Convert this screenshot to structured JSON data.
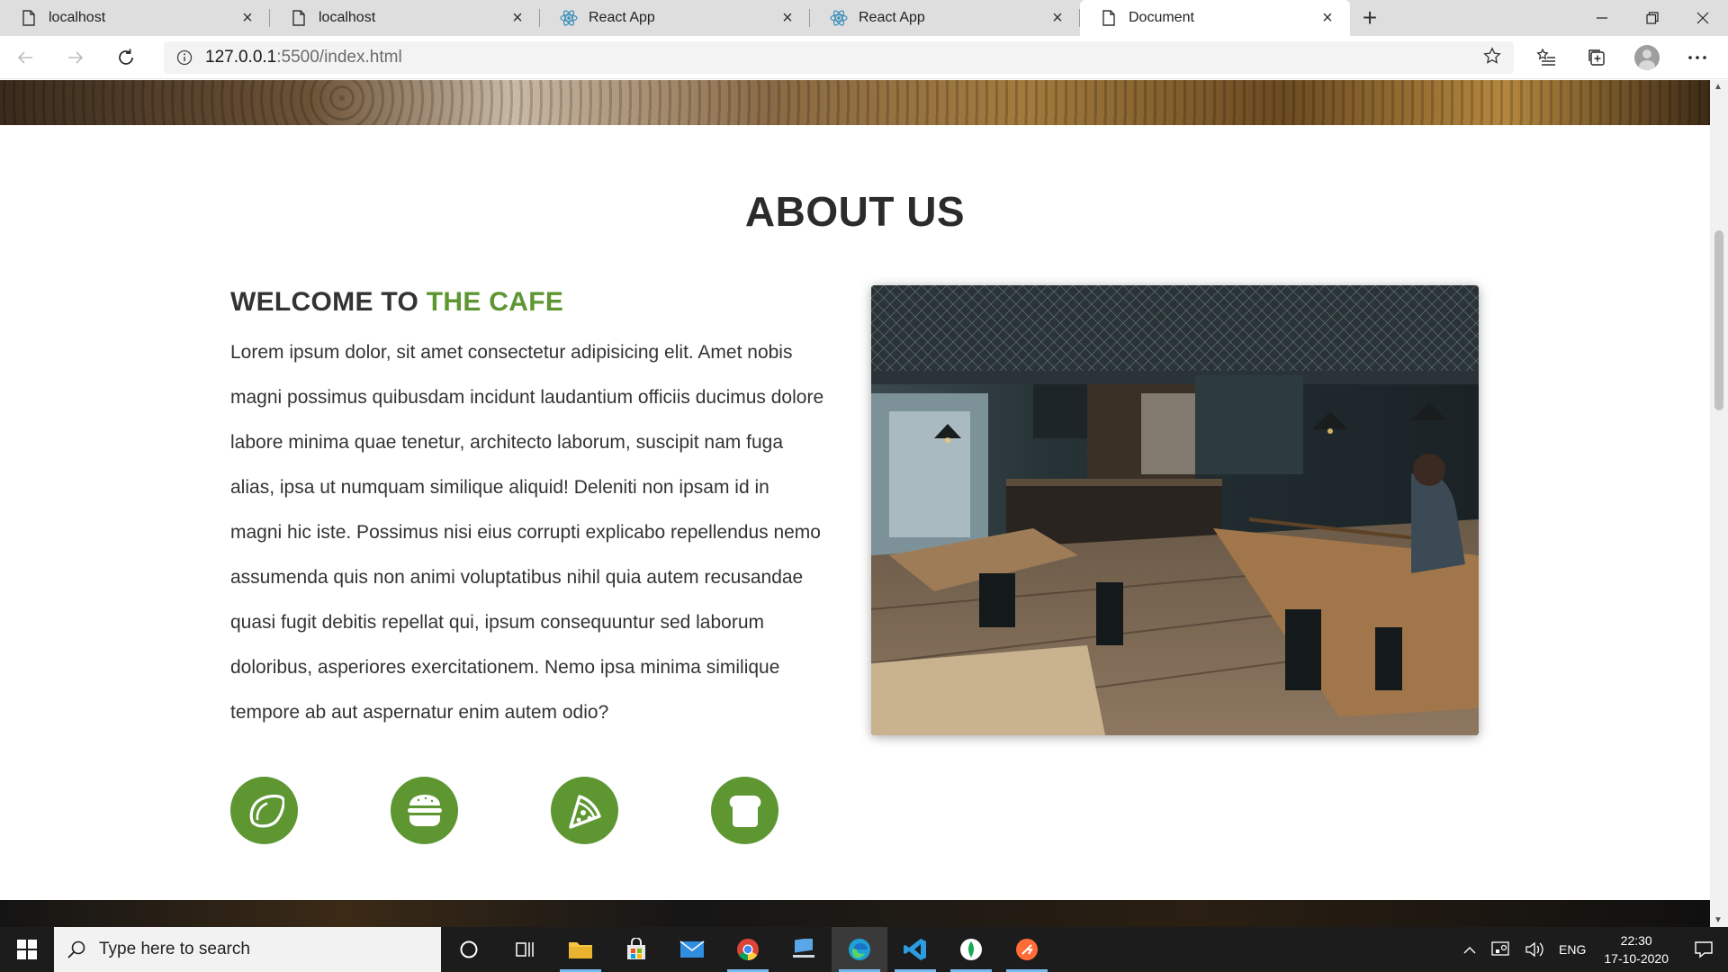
{
  "browser": {
    "tabs": [
      {
        "label": "localhost",
        "icon": "page-icon"
      },
      {
        "label": "localhost",
        "icon": "page-icon"
      },
      {
        "label": "React App",
        "icon": "react-icon"
      },
      {
        "label": "React App",
        "icon": "react-icon"
      },
      {
        "label": "Document",
        "icon": "page-icon",
        "active": true
      }
    ],
    "url_host": "127.0.0.1",
    "url_path": ":5500/index.html"
  },
  "page": {
    "about_title": "ABOUT US",
    "welcome_prefix": "WELCOME TO",
    "welcome_accent": "THE CAFE",
    "paragraph": "Lorem ipsum dolor, sit amet consectetur adipisicing elit. Amet nobis magni possimus quibusdam incidunt laudantium officiis ducimus dolore labore minima quae tenetur, architecto laborum, suscipit nam fuga alias, ipsa ut numquam similique aliquid! Deleniti non ipsam id in magni hic iste. Possimus nisi eius corrupti explicabo repellendus nemo assumenda quis non animi voluptatibus nihil quia autem recusandae quasi fugit debitis repellat qui, ipsum consequuntur sed laborum doloribus, asperiores exercitationem. Nemo ipsa minima similique tempore ab aut aspernatur enim autem odio?",
    "feature_icons": [
      "lemon-icon",
      "hamburger-icon",
      "pizza-slice-icon",
      "bread-icon"
    ],
    "accent_color": "#5e9632"
  },
  "taskbar": {
    "search_placeholder": "Type here to search",
    "language": "ENG",
    "time": "22:30",
    "date": "17-10-2020"
  }
}
